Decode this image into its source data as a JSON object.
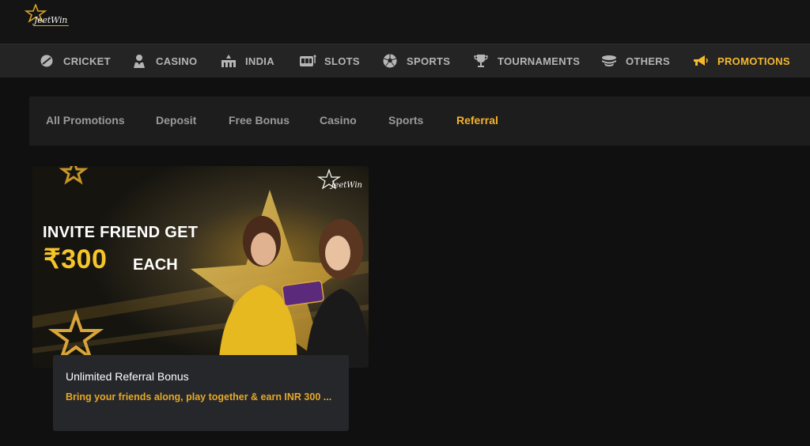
{
  "brand": {
    "logo_text": "JeetWin"
  },
  "nav": {
    "items": [
      {
        "label": "CRICKET",
        "icon": "cricket-ball-icon"
      },
      {
        "label": "CASINO",
        "icon": "casino-dealer-icon"
      },
      {
        "label": "INDIA",
        "icon": "india-temple-icon"
      },
      {
        "label": "SLOTS",
        "icon": "slot-machine-icon"
      },
      {
        "label": "SPORTS",
        "icon": "soccer-ball-icon"
      },
      {
        "label": "TOURNAMENTS",
        "icon": "trophy-icon"
      },
      {
        "label": "OTHERS",
        "icon": "stack-icon"
      },
      {
        "label": "PROMOTIONS",
        "icon": "megaphone-icon",
        "active": true
      }
    ]
  },
  "tabs": [
    {
      "label": "All Promotions"
    },
    {
      "label": "Deposit"
    },
    {
      "label": "Free Bonus"
    },
    {
      "label": "Casino"
    },
    {
      "label": "Sports"
    },
    {
      "label": "Referral",
      "active": true
    }
  ],
  "promo": {
    "banner": {
      "headline": "INVITE FRIEND GET",
      "amount": "₹300",
      "suffix": "EACH",
      "logo_text": "JeetWin"
    },
    "title": "Unlimited Referral Bonus",
    "description": "Bring your friends along, play together & earn INR 300 ..."
  },
  "colors": {
    "accent": "#f5b92d",
    "nav_bg": "#242424",
    "page_bg": "#101010",
    "card_bg": "#26272b"
  }
}
